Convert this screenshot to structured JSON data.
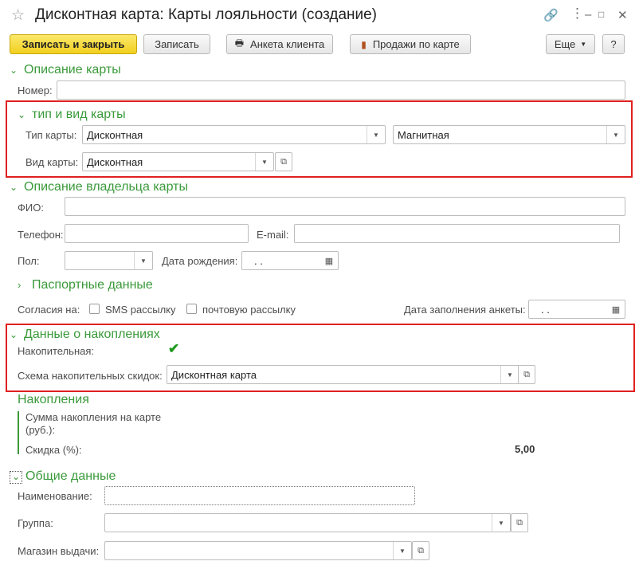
{
  "window": {
    "title": "Дисконтная карта: Карты лояльности (создание)"
  },
  "toolbar": {
    "save_close": "Записать и закрыть",
    "save": "Записать",
    "client_form": "Анкета клиента",
    "sales_by_card": "Продажи по карте",
    "more": "Еще",
    "help": "?"
  },
  "card_desc": {
    "header": "Описание карты",
    "number_label": "Номер:",
    "number_value": ""
  },
  "card_type": {
    "header": "тип и вид карты",
    "type_label": "Тип карты:",
    "type_value": "Дисконтная",
    "type2_value": "Магнитная",
    "kind_label": "Вид карты:",
    "kind_value": "Дисконтная"
  },
  "owner": {
    "header": "Описание владельца карты",
    "fio_label": "ФИО:",
    "fio_value": "",
    "phone_label": "Телефон:",
    "phone_value": "",
    "email_label": "E-mail:",
    "email_value": "",
    "sex_label": "Пол:",
    "sex_value": "",
    "birth_label": "Дата рождения:",
    "birth_value": ".   .",
    "passport_header": "Паспортные данные",
    "consent_label": "Согласия на:",
    "sms_label": "SMS рассылку",
    "mail_label": "почтовую рассылку",
    "form_date_label": "Дата заполнения анкеты:",
    "form_date_value": ".   ."
  },
  "accum": {
    "header": "Данные о накоплениях",
    "cumulative_label": "Накопительная:",
    "cumulative_checked": true,
    "scheme_label": "Схема накопительных скидок:",
    "scheme_value": "Дисконтная карта"
  },
  "savings": {
    "header": "Накопления",
    "sum_label": "Сумма накопления на карте (руб.):",
    "sum_value": "",
    "discount_label": "Скидка (%):",
    "discount_value": "5,00"
  },
  "general": {
    "header": "Общие данные",
    "name_label": "Наименование:",
    "name_value": "",
    "group_label": "Группа:",
    "group_value": "",
    "store_label": "Магазин выдачи:",
    "store_value": ""
  },
  "colors": {
    "accent_green": "#3a9a3a",
    "highlight_red": "#e02020",
    "primary_yellow": "#f2cf1f"
  },
  "icons": {
    "star": "star-icon",
    "link": "link-icon",
    "more": "more-vertical-icon",
    "minimize": "minimize-icon",
    "maximize": "maximize-icon",
    "close": "close-icon",
    "print": "printer-icon",
    "chart": "bar-chart-icon",
    "calendar": "calendar-icon",
    "open": "open-window-icon"
  }
}
